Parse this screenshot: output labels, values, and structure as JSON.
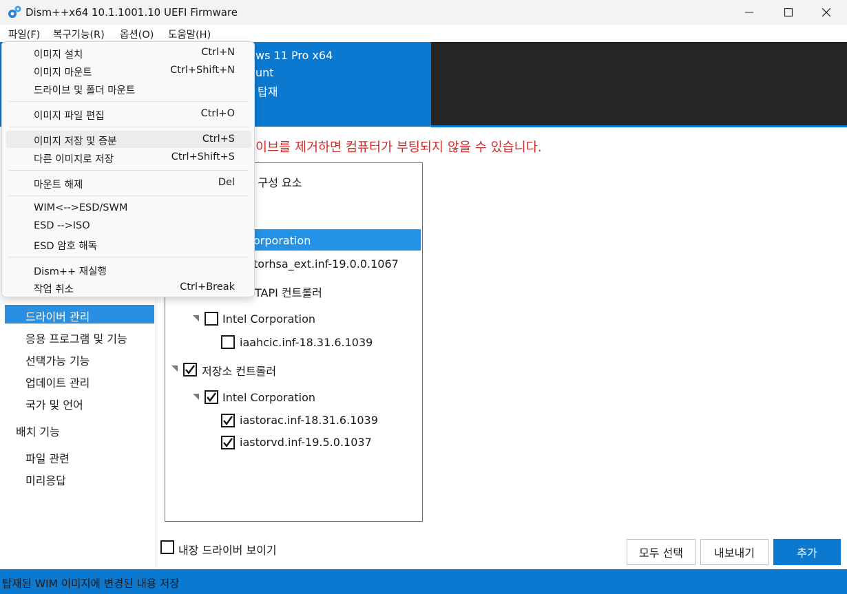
{
  "window": {
    "title": "Dism++x64 10.1.1001.10 UEFI Firmware",
    "icon": "gears-icon"
  },
  "menubar": {
    "file": "파일(F)",
    "restore": "복구기능(R)",
    "options": "옵션(O)",
    "help": "도움말(H)"
  },
  "header": {
    "line1": "ws 11 Pro x64",
    "line2": "unt",
    "line3": "탑재"
  },
  "warning": "이브를 제거하면 컴퓨터가 부팅되지 않을 수 있습니다.",
  "leftnav": {
    "items": [
      "드라이버 관리",
      "응용 프로그램 및 기능",
      "선택가능 기능",
      "업데이트 관리",
      "국가 및 언어"
    ],
    "section2": "배치 기능",
    "items2": [
      "파일 관련",
      "미리응답"
    ]
  },
  "tree": {
    "row1": "l 구성 요소",
    "row2": "orporation",
    "row3": "torhsa_ext.inf-19.0.0.1067",
    "row4": "TAPI 컨트롤러",
    "row5": "Intel Corporation",
    "row6": "iaahcic.inf-18.31.6.1039",
    "row7": "저장소 컨트롤러",
    "row8": "Intel Corporation",
    "row9": "iastorac.inf-18.31.6.1039",
    "row10": "iastorvd.inf-19.5.0.1037"
  },
  "bottom": {
    "show_builtin": "내장 드라이버 보이기",
    "select_all": "모두 선택",
    "export": "내보내기",
    "add": "추가"
  },
  "status": "탑재된 WIM 이미지에 변경된 내용 저장",
  "dropdown": {
    "items": [
      {
        "label": "이미지 설치",
        "shortcut": "Ctrl+N"
      },
      {
        "label": "이미지 마운트",
        "shortcut": "Ctrl+Shift+N"
      },
      {
        "label": "드라이브 및 폴더 마운트",
        "shortcut": ""
      },
      {
        "label": "이미지 파일 편집",
        "shortcut": "Ctrl+O"
      },
      {
        "label": "이미지 저장 및 증분",
        "shortcut": "Ctrl+S"
      },
      {
        "label": "다른 이미지로 저장",
        "shortcut": "Ctrl+Shift+S"
      },
      {
        "label": "마운트 해제",
        "shortcut": "Del"
      },
      {
        "label": "WIM<-->ESD/SWM",
        "shortcut": ""
      },
      {
        "label": "ESD -->ISO",
        "shortcut": ""
      },
      {
        "label": "ESD 암호 해독",
        "shortcut": ""
      },
      {
        "label": "Dism++ 재실행",
        "shortcut": ""
      },
      {
        "label": "작업 취소",
        "shortcut": "Ctrl+Break"
      }
    ]
  },
  "colors": {
    "accent": "#0b79d0",
    "selection": "#2492e6",
    "warning": "#d12a2a",
    "header_dark": "#252525"
  }
}
